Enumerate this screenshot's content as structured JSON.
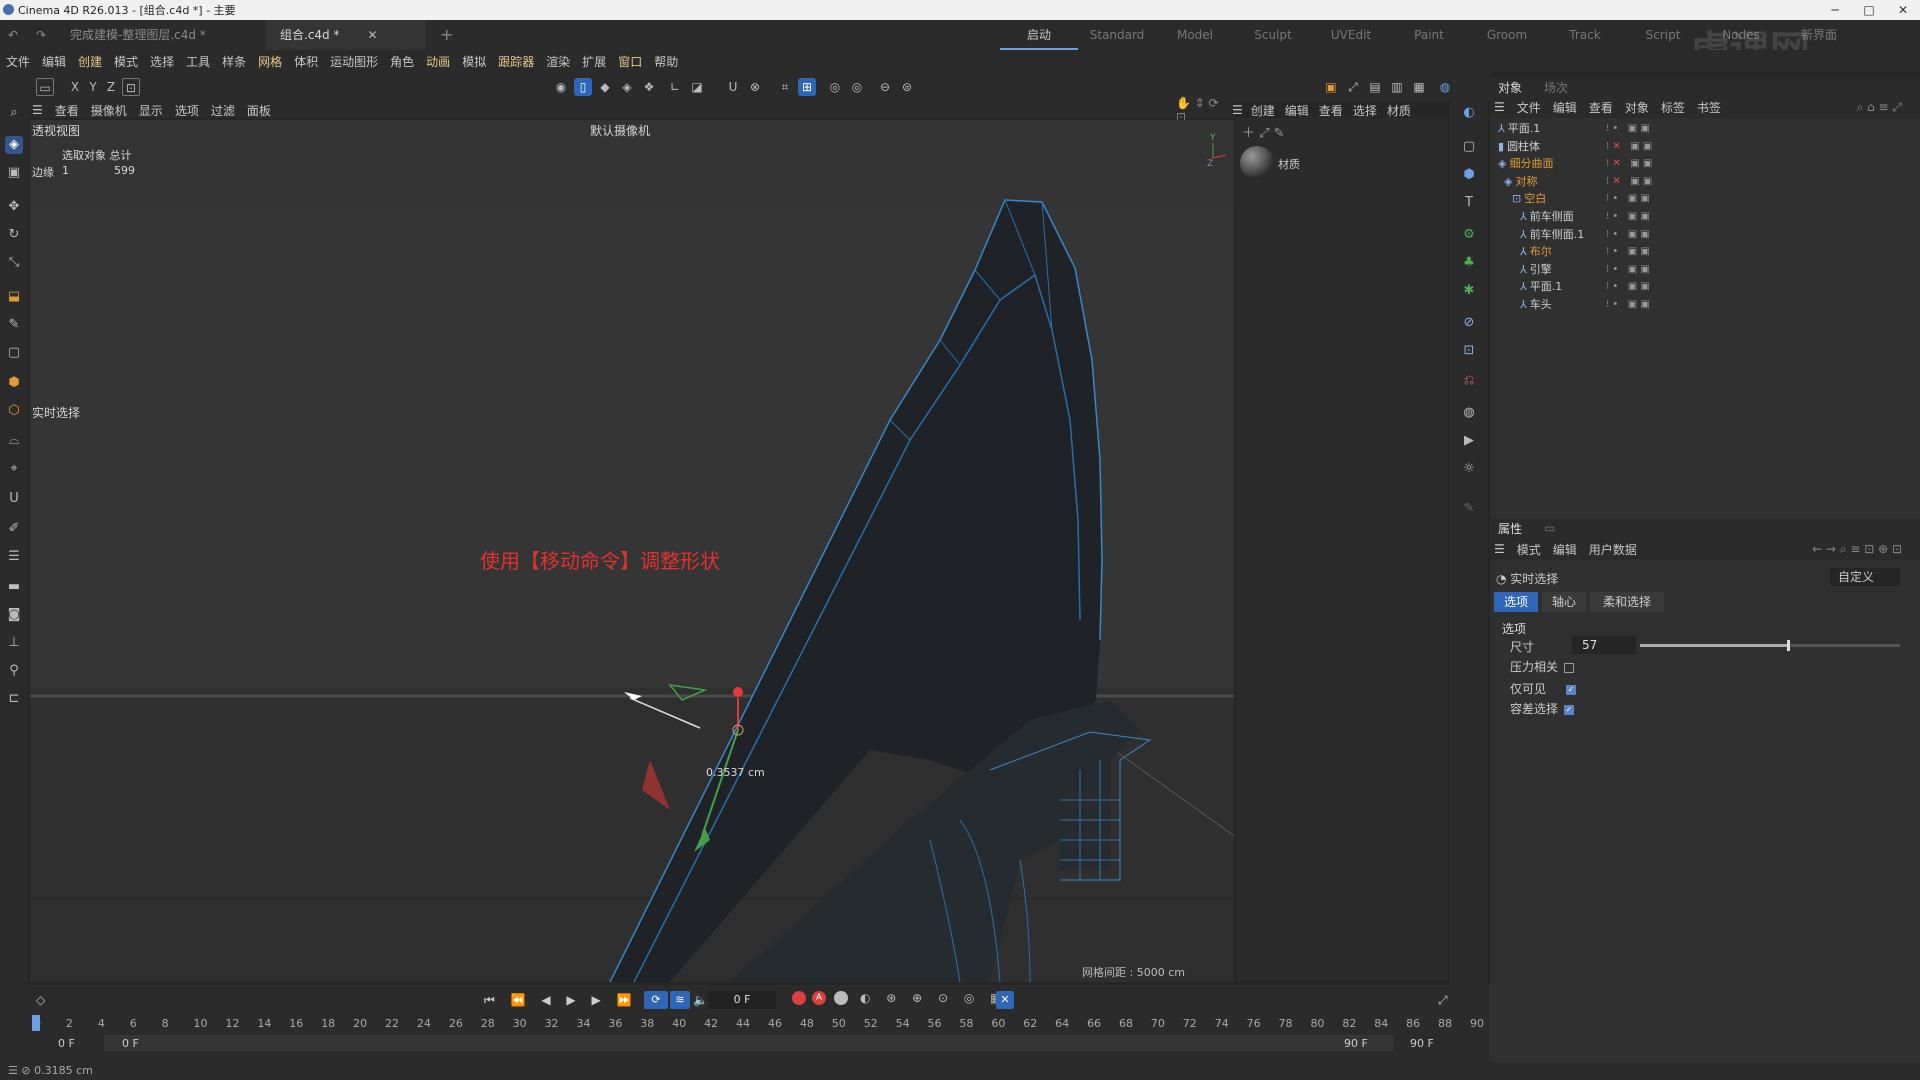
{
  "window": {
    "title": "Cinema 4D R26.013 - [组合.c4d *] - 主要",
    "controls": [
      "─",
      "□",
      "✕"
    ]
  },
  "doc_tabs": [
    {
      "label": "完成建模-整理图层.c4d *"
    },
    {
      "label": "组合.c4d *"
    }
  ],
  "layouts": [
    "启动",
    "Standard",
    "Model",
    "Sculpt",
    "UVEdit",
    "Paint",
    "Groom",
    "Track",
    "Script",
    "Nodes",
    "新界面"
  ],
  "active_layout": "启动",
  "menu": [
    "文件",
    "编辑",
    "创建",
    "模式",
    "选择",
    "工具",
    "样条",
    "网格",
    "体积",
    "运动图形",
    "角色",
    "动画",
    "模拟",
    "跟踪器",
    "渲染",
    "扩展",
    "窗口",
    "帮助"
  ],
  "viewport_menu": [
    "查看",
    "摄像机",
    "显示",
    "选项",
    "过滤",
    "面板"
  ],
  "viewport": {
    "name": "透视视图",
    "camera": "默认摄像机",
    "stats_header": "选取对象 总计",
    "stats_label": "边缘",
    "stats_selected": "1",
    "stats_total": "599",
    "live_selection": "实时选择",
    "annotation": "使用【移动命令】调整形状",
    "measure": "0.3537 cm",
    "grid": "网格间距 : 5000 cm"
  },
  "right_panel_menu": [
    "创建",
    "编辑",
    "查看",
    "选择",
    "材质"
  ],
  "material": {
    "name": "材质"
  },
  "object_manager": {
    "tabs": [
      "对象",
      "场次"
    ],
    "menu": [
      "文件",
      "编辑",
      "查看",
      "对象",
      "标签",
      "书签"
    ],
    "objects": [
      {
        "name": "平面.1",
        "color": "#d0d0d0"
      },
      {
        "name": "圆柱体",
        "color": "#d0d0d0"
      },
      {
        "name": "细分曲面",
        "color": "#e09a3a"
      },
      {
        "name": "对称",
        "color": "#e09a3a"
      },
      {
        "name": "空白",
        "color": "#e09a3a"
      },
      {
        "name": "前车侧面",
        "color": "#d0d0d0"
      },
      {
        "name": "前车侧面.1",
        "color": "#d0d0d0"
      },
      {
        "name": "布尔",
        "color": "#e09a3a"
      },
      {
        "name": "引擎",
        "color": "#d0d0d0"
      },
      {
        "name": "平面.1",
        "color": "#d0d0d0"
      },
      {
        "name": "车头",
        "color": "#d0d0d0"
      }
    ]
  },
  "attributes": {
    "tab": "属性",
    "menu": [
      "模式",
      "编辑",
      "用户数据"
    ],
    "tool": "实时选择",
    "preset": "自定义",
    "subtabs": [
      "选项",
      "轴心",
      "柔和选择"
    ],
    "section": "选项",
    "size_label": "尺寸",
    "size_value": "57",
    "size_fraction": 0.57,
    "pressure_label": "压力相关",
    "visible_only_label": "仅可见",
    "tolerant_label": "容差选择"
  },
  "timeline": {
    "current_frame": "0 F",
    "start": "0 F",
    "start2": "0 F",
    "end": "90 F",
    "end2": "90 F",
    "ticks": [
      "0",
      "2",
      "4",
      "6",
      "8",
      "10",
      "12",
      "14",
      "16",
      "18",
      "20",
      "22",
      "24",
      "26",
      "28",
      "30",
      "32",
      "34",
      "36",
      "38",
      "40",
      "42",
      "44",
      "46",
      "48",
      "50",
      "52",
      "54",
      "56",
      "58",
      "60",
      "62",
      "64",
      "66",
      "68",
      "70",
      "72",
      "74",
      "76",
      "78",
      "80",
      "82",
      "84",
      "86",
      "88",
      "90"
    ]
  },
  "status": {
    "text": "0.3185 cm"
  },
  "watermark": "虎课网",
  "colors": {
    "accent": "#2f66b8",
    "annotation": "#e0332f",
    "orange": "#e09a3a"
  }
}
